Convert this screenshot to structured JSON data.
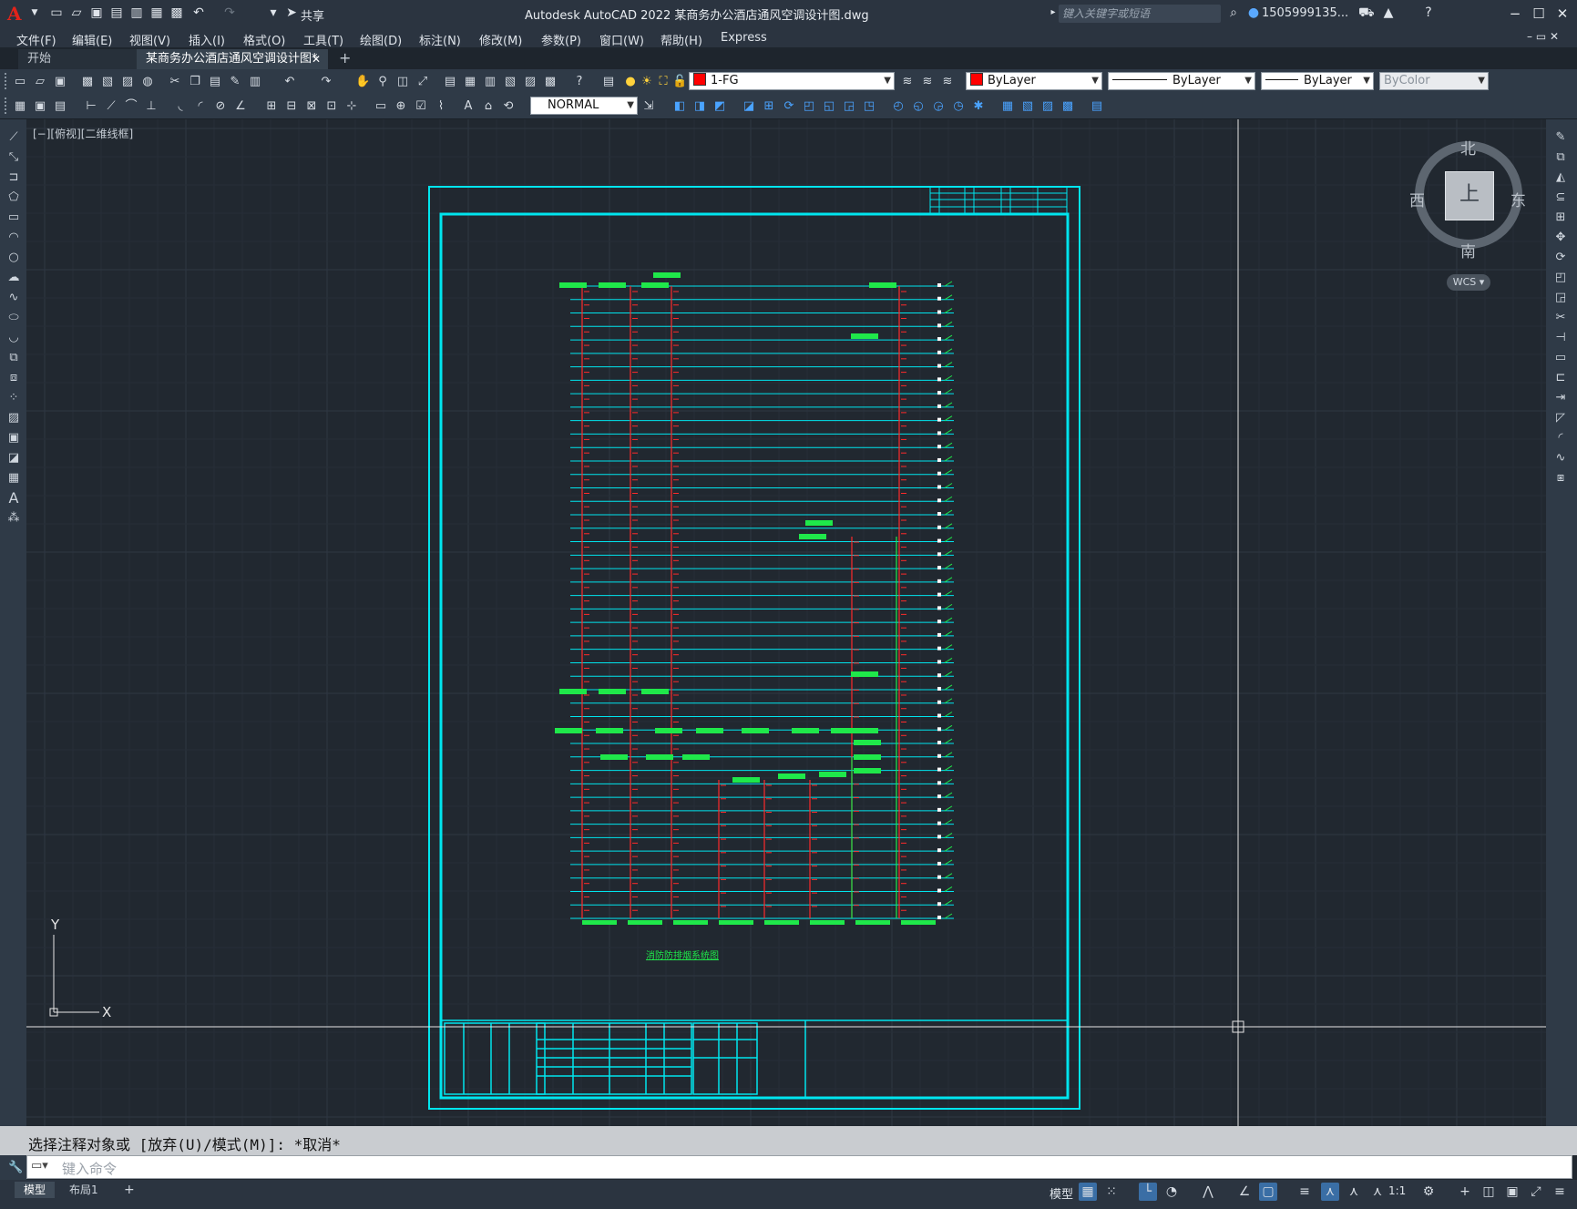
{
  "app": {
    "logo": "A",
    "share_label": "共享",
    "title": "Autodesk AutoCAD 2022    某商务办公酒店通风空调设计图.dwg",
    "search_placeholder": "键入关键字或短语",
    "user": "1505999135...",
    "window_controls": [
      "−",
      "☐",
      "✕"
    ]
  },
  "menu": [
    "文件(F)",
    "编辑(E)",
    "视图(V)",
    "插入(I)",
    "格式(O)",
    "工具(T)",
    "绘图(D)",
    "标注(N)",
    "修改(M)",
    "参数(P)",
    "窗口(W)",
    "帮助(H)",
    "Express"
  ],
  "tabs": {
    "start": "开始",
    "drawing": "某商务办公酒店通风空调设计图*",
    "close": "✕",
    "add": "+"
  },
  "properties": {
    "layer": "1-FG",
    "color": "ByLayer",
    "linetype": "ByLayer",
    "lineweight": "ByLayer",
    "plotstyle": "ByColor",
    "dim_style": "NORMAL",
    "color_swatch": "#ff0000"
  },
  "viewport": {
    "label": "[−][俯视][二维线框]",
    "compass": {
      "n": "北",
      "s": "南",
      "e": "东",
      "w": "西"
    },
    "cube_face": "上",
    "wcs": "WCS ▾",
    "ucs_x": "X",
    "ucs_y": "Y"
  },
  "drawing": {
    "diagram_title": "消防防排烟系统图"
  },
  "command": {
    "history": "选择注释对象或 [放弃(U)/模式(M)]: *取消*",
    "placeholder": "键入命令"
  },
  "status": {
    "model_tab": "模型",
    "layout_tab": "布局1",
    "add_tab": "+",
    "model_button": "模型",
    "scale": "1:1"
  },
  "colors": {
    "background": "#212830",
    "frame": "#00e5ee",
    "duct_green": "#1fe84a",
    "riser_red": "#ff2a2a"
  }
}
